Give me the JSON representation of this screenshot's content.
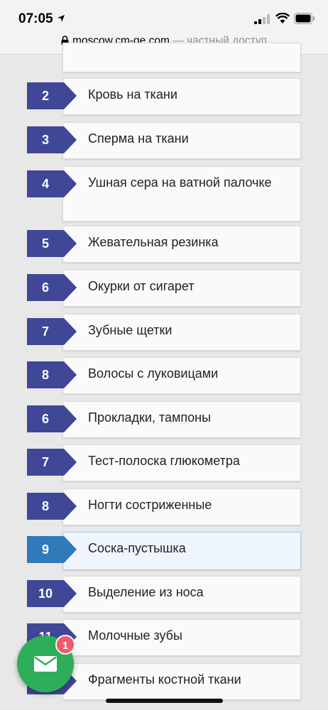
{
  "status_bar": {
    "time": "07:05",
    "icons": [
      "location-arrow-icon",
      "signal-icon",
      "wifi-icon",
      "battery-icon"
    ]
  },
  "url_bar": {
    "domain": "moscow.cm-ge.com",
    "suffix": " — частный доступ",
    "icon": "lock-icon"
  },
  "list": {
    "items": [
      {
        "num": "2",
        "label": "Кровь на ткани"
      },
      {
        "num": "3",
        "label": "Сперма на ткани"
      },
      {
        "num": "4",
        "label": "Ушная сера на ватной палочке"
      },
      {
        "num": "5",
        "label": "Жевательная резинка"
      },
      {
        "num": "6",
        "label": "Окурки от сигарет"
      },
      {
        "num": "7",
        "label": "Зубные щетки"
      },
      {
        "num": "8",
        "label": "Волосы с луковицами"
      },
      {
        "num": "6",
        "label": "Прокладки, тампоны"
      },
      {
        "num": "7",
        "label": "Тест-полоска глюкометра"
      },
      {
        "num": "8",
        "label": "Ногти состриженные"
      },
      {
        "num": "9",
        "label": "Соска-пустышка"
      },
      {
        "num": "10",
        "label": "Выделение из носа"
      },
      {
        "num": "11",
        "label": "Молочные зубы"
      },
      {
        "num": "",
        "label": "Фрагменты костной ткани"
      }
    ]
  },
  "chat_button": {
    "icon": "envelope-icon",
    "unread": "1"
  },
  "colors": {
    "badge": "#3f4796",
    "badge_active": "#2f7ab9",
    "chat": "#2fae59",
    "unread": "#f05a6e"
  }
}
